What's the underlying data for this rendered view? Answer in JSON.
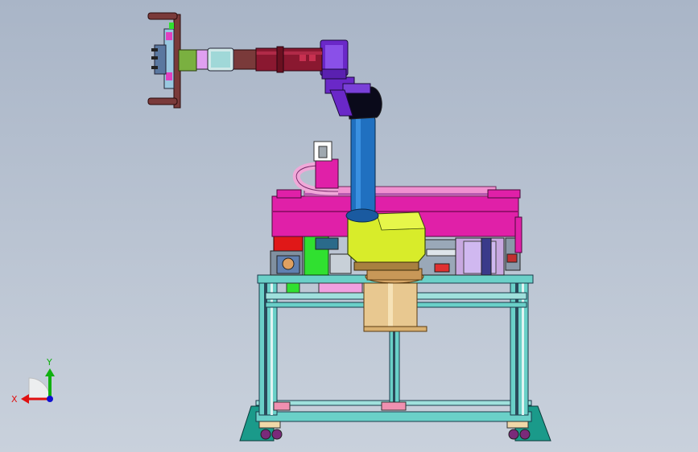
{
  "viewport": {
    "background_top": "#a9b5c7",
    "background_bottom": "#c9d1dc"
  },
  "triad": {
    "x_label": "X",
    "y_label": "Y",
    "x_color": "#e01010",
    "y_color": "#10b010",
    "z_color": "#1010d0"
  },
  "colors": {
    "frame": "#6ad0c8",
    "upper_carriage": "#e020a8",
    "rail": "#f090d0",
    "robot_base": "#d8ec2a",
    "robot_arm": "#2070c0",
    "robot_wrist": "#6a28c8",
    "forearm": "#8a1830",
    "gripper": "#7a3a3a",
    "column": "#e8c890",
    "base_plate": "#1a9a8a",
    "red_block": "#e01818",
    "green_block": "#30e030"
  }
}
